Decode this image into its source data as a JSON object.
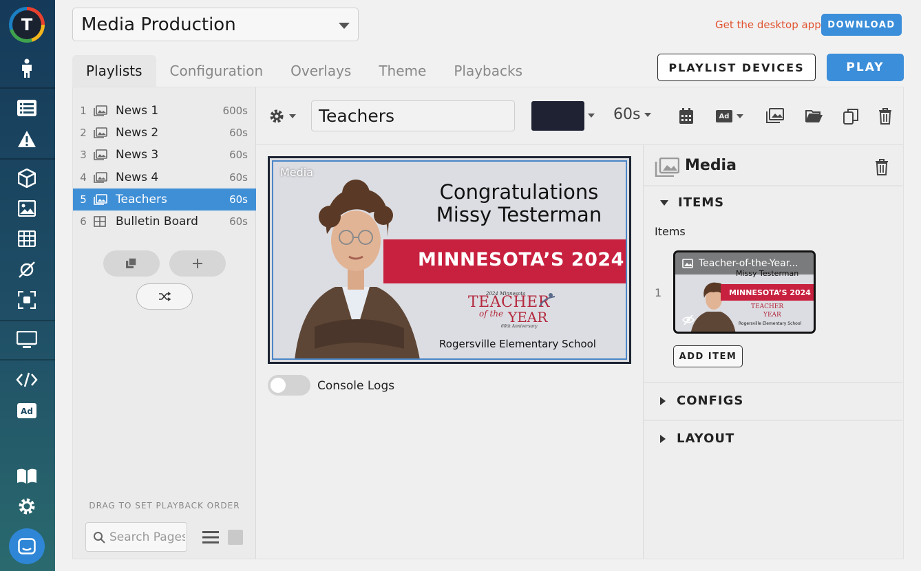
{
  "sidebar": {
    "logo_letter": "T"
  },
  "header": {
    "project": "Media Production",
    "desktop_link": "Get the desktop app",
    "download_label": "DOWNLOAD"
  },
  "tabs": [
    {
      "label": "Playlists"
    },
    {
      "label": "Configuration"
    },
    {
      "label": "Overlays"
    },
    {
      "label": "Theme"
    },
    {
      "label": "Playbacks"
    }
  ],
  "actions": {
    "playlist_devices": "PLAYLIST DEVICES",
    "play": "PLAY"
  },
  "playlist": {
    "items": [
      {
        "num": "1",
        "name": "News 1",
        "duration": "600s"
      },
      {
        "num": "2",
        "name": "News 2",
        "duration": "60s"
      },
      {
        "num": "3",
        "name": "News 3",
        "duration": "60s"
      },
      {
        "num": "4",
        "name": "News 4",
        "duration": "60s"
      },
      {
        "num": "5",
        "name": "Teachers",
        "duration": "60s"
      },
      {
        "num": "6",
        "name": "Bulletin Board",
        "duration": "60s"
      }
    ],
    "drag_hint": "DRAG TO SET PLAYBACK ORDER",
    "search_placeholder": "Search Pages"
  },
  "toolbar": {
    "page_name": "Teachers",
    "duration": "60s",
    "ad_badge": "Ad",
    "swatch_color": "#1f2233"
  },
  "preview": {
    "tag": "Media",
    "congrats_line1": "Congratulations",
    "congrats_line2": "Missy Testerman",
    "banner": "MINNESOTA’S 2024",
    "toty_small": "2024 Minnesota",
    "toty_teacher": "TEACHER",
    "toty_of_the": "of the",
    "toty_year": "YEAR",
    "toty_anniv": "60th Anniversary",
    "school": "Rogersville Elementary School"
  },
  "console": {
    "label": "Console Logs"
  },
  "panel": {
    "title": "Media",
    "items_header": "ITEMS",
    "items_label": "Items",
    "item_index": "1",
    "item_title": "Teacher-of-the-Year...",
    "thumb_sub": "Missy Testerman",
    "thumb_banner": "MINNESOTA’S 2024",
    "thumb_school": "Rogersville Elementary School",
    "thumb_toty_teacher": "TEACHER",
    "thumb_toty_year": "YEAR",
    "add_item": "ADD ITEM",
    "configs_header": "CONFIGS",
    "layout_header": "LAYOUT"
  },
  "colors": {
    "accent": "#3b8ed9",
    "selected_row": "#3f8fd6",
    "banner_red": "#c8203f",
    "link_orange": "#e0522f"
  }
}
